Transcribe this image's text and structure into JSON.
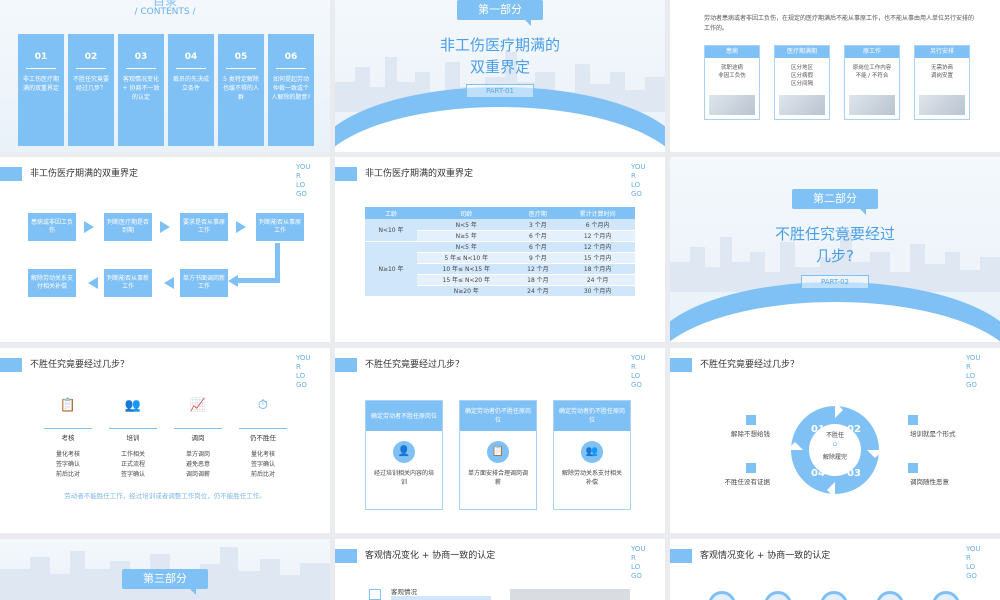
{
  "s1": {
    "heading_cut": "目录",
    "contents": "/ CONTENTS /",
    "items": [
      {
        "n": "01",
        "d": "非工伤医疗期满的双重界定"
      },
      {
        "n": "02",
        "d": "不胜任究竟要经过几步？"
      },
      {
        "n": "03",
        "d": "客观情况变化 + 协商不一致的认定"
      },
      {
        "n": "04",
        "d": "裁员的先决成立条件"
      },
      {
        "n": "05",
        "d": "5 类特定解除也缓不得的人群"
      },
      {
        "n": "06",
        "d": "如何提起劳动仲裁一致或个人解除的题意?"
      }
    ]
  },
  "s2": {
    "tag": "第一部分",
    "title1": "非工伤医疗期满的",
    "title2": "双重界定",
    "part": "PART-01"
  },
  "s3": {
    "text": "劳动者患病或者非因工负伤，在规定的医疗期满后不能从事原工作，也不能从事由用人单位另行安排的工作的。",
    "cards": [
      {
        "h": "患病",
        "d": "就职途病\n非因工负伤"
      },
      {
        "h": "医疗期满期",
        "d": "区分地区\n区分病假\n区分间隔"
      },
      {
        "h": "原工作",
        "d": "原岗位工作内容\n不能 / 不符合"
      },
      {
        "h": "另行安排",
        "d": "无需协商\n调岗安置"
      }
    ]
  },
  "logo": [
    "YOU",
    "R",
    "LO",
    "GO"
  ],
  "s4": {
    "title": "非工伤医疗期满的双重界定",
    "flow": [
      "患病或非因工负伤",
      "判断医疗期是否到期",
      "要求是否从事原工作",
      "判断能否从事原工作",
      "单方书面调岗新工作",
      "判断能否从事新工作",
      "解除劳动关系支付相关补偿"
    ]
  },
  "s5": {
    "title": "非工伤医疗期满的双重界定",
    "headers": [
      "工龄",
      "司龄",
      "医疗期",
      "累计计算时间"
    ],
    "groupA": "N<10 年",
    "groupB": "N≥10 年",
    "rows": [
      [
        "N<5 年",
        "3 个月",
        "6 个月内"
      ],
      [
        "N≥5 年",
        "6 个月",
        "12 个月内"
      ],
      [
        "N<5 年",
        "6 个月",
        "12 个月内"
      ],
      [
        "5 年≤ N<10 年",
        "9 个月",
        "15 个月内"
      ],
      [
        "10 年≤ N<15 年",
        "12 个月",
        "18 个月内"
      ],
      [
        "15 年≤ N<20 年",
        "18 个月",
        "24 个月"
      ],
      [
        "N≥20 年",
        "24 个月",
        "30 个月内"
      ]
    ]
  },
  "s6": {
    "tag": "第二部分",
    "title1": "不胜任究竟要经过",
    "title2": "几步?",
    "part": "PART-02"
  },
  "s7": {
    "title": "不胜任究竟要经过几步？",
    "cols": [
      {
        "h": "考核",
        "d": [
          "量化考核",
          "签字确认",
          "前后比对"
        ]
      },
      {
        "h": "培训",
        "d": [
          "工作相关",
          "正式流程",
          "签字确认"
        ]
      },
      {
        "h": "调岗",
        "d": [
          "单方调岗",
          "避免恶意",
          "调岗调薪"
        ]
      },
      {
        "h": "仍不胜任",
        "d": [
          "量化考核",
          "签字确认",
          "前后比对"
        ]
      }
    ],
    "note": "劳动者不能胜任工作，经过培训或者调整工作岗位，仍不能胜任工作。"
  },
  "s8": {
    "title": "不胜任究竟要经过几步？",
    "cards": [
      {
        "h": "确定劳动者不胜任原岗位",
        "d": "经过培训相关内容的培训"
      },
      {
        "h": "确定劳动者仍不胜任原岗位",
        "d": "单方面安排合理调岗调薪"
      },
      {
        "h": "确定劳动者仍不胜任原岗位",
        "d": "解除劳动关系支付相关补偿"
      }
    ]
  },
  "s9": {
    "title": "不胜任究竟要经过几步？",
    "nums": [
      "01",
      "02",
      "03",
      "04"
    ],
    "center1": "不胜任",
    "center2": "解除履完",
    "labels": [
      "解除不想给钱",
      "培训就是个形式",
      "不胜任没有证据",
      "调岗随性恶意"
    ]
  },
  "s10": {
    "tag": "第三部分"
  },
  "s11": {
    "title": "客观情况变化 + 协商一致的认定",
    "sub": "客观情况"
  },
  "s12": {
    "title": "客观情况变化 + 协商一致的认定"
  }
}
